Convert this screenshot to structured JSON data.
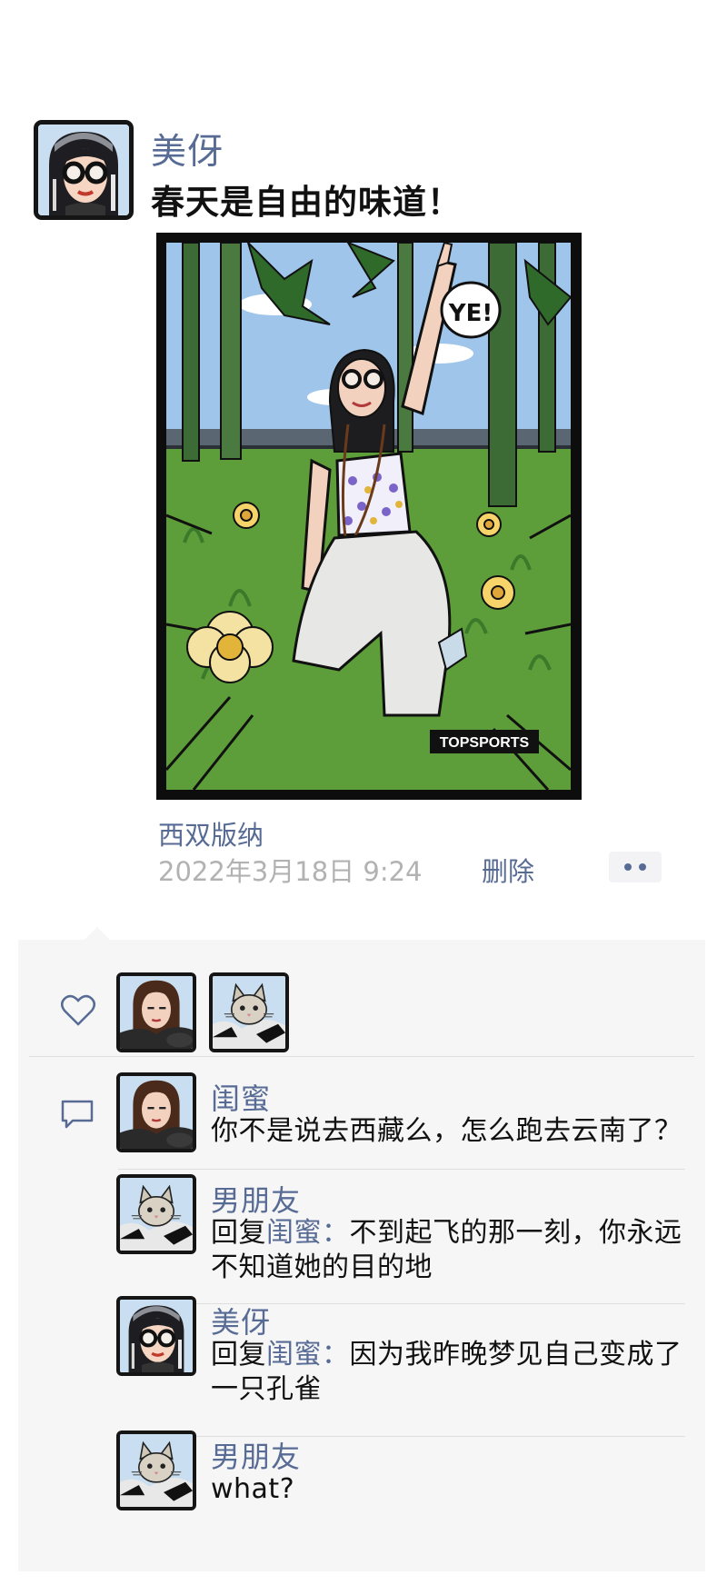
{
  "post": {
    "author": "美伢",
    "text": "春天是自由的味道！",
    "image_badge": "TOPSPORTS",
    "speech_bubble": "YE!",
    "location": "西双版纳",
    "time": "2022年3月18日   9:24",
    "delete_label": "删除"
  },
  "likes": {
    "users": [
      "闺蜜",
      "男朋友"
    ]
  },
  "comments": [
    {
      "author": "闺蜜",
      "avatar": "girl-avatar",
      "reply_prefix": "",
      "reply_to": "",
      "text": "你不是说去西藏么，怎么跑去云南了？"
    },
    {
      "author": "男朋友",
      "avatar": "cat-avatar",
      "reply_prefix": "回复",
      "reply_to": "闺蜜：",
      "text": "不到起飞的那一刻，你永远不知道她的目的地"
    },
    {
      "author": "美伢",
      "avatar": "glasses-girl-avatar",
      "reply_prefix": "回复",
      "reply_to": "闺蜜：",
      "text": "因为我昨晚梦见自己变成了一只孔雀"
    },
    {
      "author": "男朋友",
      "avatar": "cat-avatar",
      "reply_prefix": "",
      "reply_to": "",
      "text": "what?"
    }
  ],
  "colors": {
    "link": "#576b95",
    "meta": "#b2b2b2",
    "panel": "#f6f6f6",
    "text": "#111111"
  }
}
